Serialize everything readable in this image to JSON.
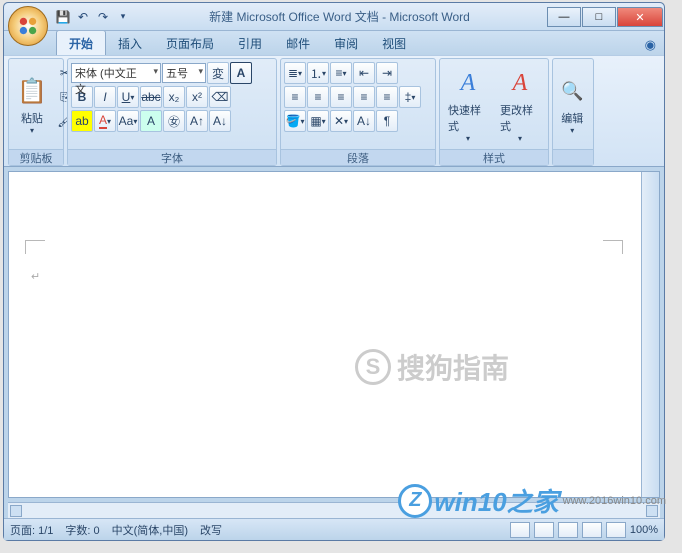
{
  "title": "新建 Microsoft Office Word 文档 - Microsoft Word",
  "tabs": [
    "开始",
    "插入",
    "页面布局",
    "引用",
    "邮件",
    "审阅",
    "视图"
  ],
  "activeTab": 0,
  "clipboard": {
    "paste": "粘贴",
    "label": "剪贴板"
  },
  "font": {
    "family": "宋体 (中文正文",
    "size": "五号",
    "label": "字体"
  },
  "paragraph": {
    "label": "段落"
  },
  "styles": {
    "quick": "快速样式",
    "change": "更改样式",
    "label": "样式"
  },
  "editing": {
    "label": "编辑"
  },
  "status": {
    "page": "页面: 1/1",
    "words": "字数: 0",
    "lang": "中文(简体,中国)",
    "mode": "改写",
    "zoom": "100%"
  },
  "watermark": {
    "brand": "win10之家",
    "url": "www.2016win10.com"
  },
  "sogou": "搜狗指南"
}
